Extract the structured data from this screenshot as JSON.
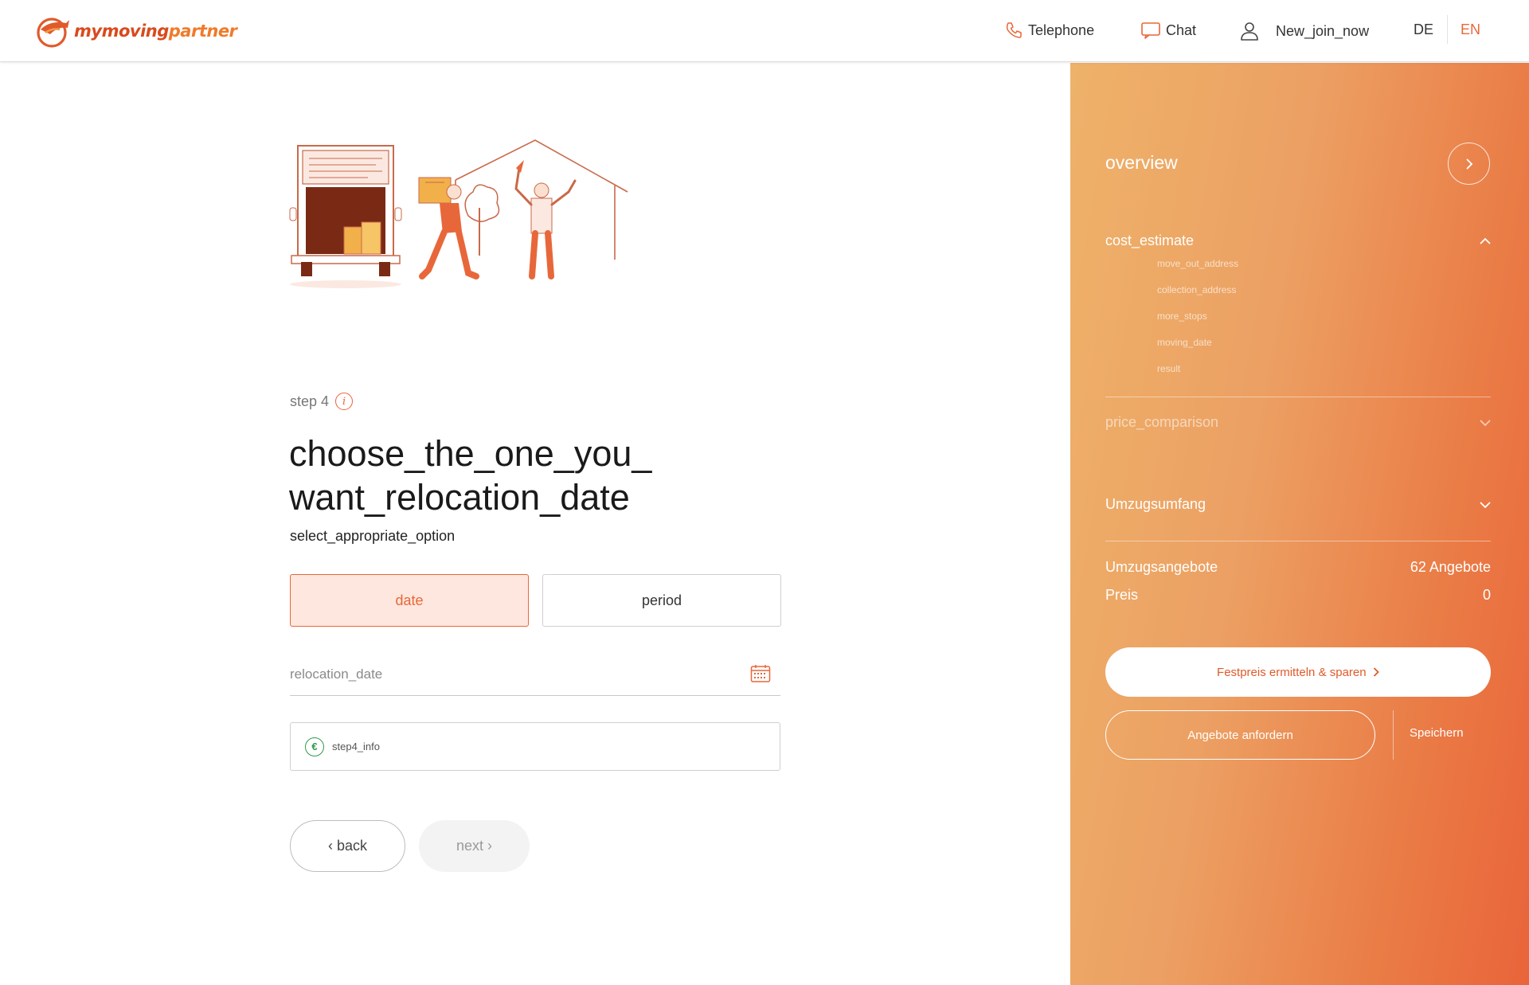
{
  "header": {
    "logo": {
      "text_my": "my",
      "text_moving": "moving",
      "text_partner": "partner",
      "icon": "logo-mark-icon"
    },
    "nav": {
      "telephone_label": "Telephone",
      "chat_label": "Chat",
      "user_label": "New_join_now",
      "lang_de": "DE",
      "lang_en": "EN",
      "active_lang": "EN"
    }
  },
  "main": {
    "step_label": "step 4",
    "title_line1": "choose_the_one_you_",
    "title_line2": "want_relocation_date",
    "subtitle": "select_appropriate_option",
    "options": {
      "date_label": "date",
      "period_label": "period",
      "selected": "date"
    },
    "date_field": {
      "placeholder": "relocation_date",
      "value": ""
    },
    "info_text": "step4_info",
    "back_label": "back",
    "next_label": "next"
  },
  "sidebar": {
    "overview_title": "overview",
    "cost_estimate": {
      "label": "cost_estimate",
      "items": [
        "move_out_address",
        "collection_address",
        "more_stops",
        "moving_date",
        "result"
      ]
    },
    "price_comparison_label": "price_comparison",
    "umzugsumfang_label": "Umzugsumfang",
    "offers_label": "Umzugsangebote",
    "offers_value": "62 Angebote",
    "price_label": "Preis",
    "price_value": "0",
    "fixed_price_button": "Festpreis ermitteln & sparen",
    "request_button": "Angebote anfordern",
    "save_label": "Speichern"
  },
  "colors": {
    "accent": "#e8673a",
    "sidebar_gradient_start": "#eeb26a",
    "sidebar_gradient_end": "#e9643a",
    "info_green": "#2e9b4a"
  }
}
